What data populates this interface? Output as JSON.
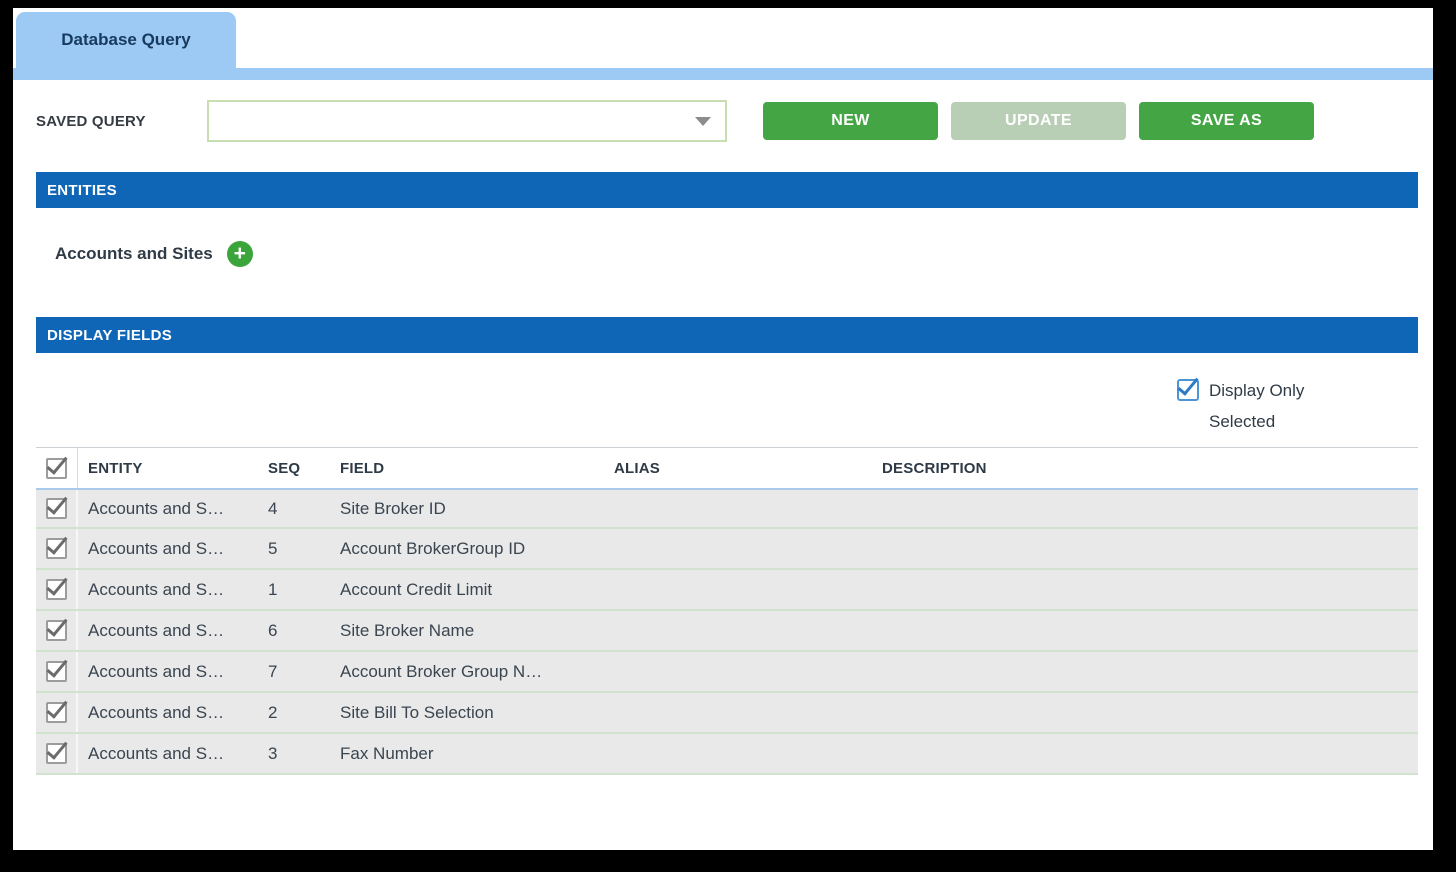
{
  "tab": {
    "label": "Database Query"
  },
  "saved_query": {
    "label": "SAVED QUERY",
    "value": "",
    "dropdown_icon": "chevron-down-icon"
  },
  "buttons": {
    "new": "NEW",
    "update": "UPDATE",
    "save_as": "SAVE AS",
    "update_disabled": true
  },
  "sections": {
    "entities": "ENTITIES",
    "display_fields": "DISPLAY FIELDS"
  },
  "entities": {
    "item_label": "Accounts and Sites",
    "add_icon": "plus-icon"
  },
  "display_options": {
    "label": "Display Only Selected",
    "checked": true
  },
  "table": {
    "select_all_checked": true,
    "columns": [
      "ENTITY",
      "SEQ",
      "FIELD",
      "ALIAS",
      "DESCRIPTION"
    ],
    "rows": [
      {
        "checked": true,
        "entity": "Accounts and S…",
        "seq": "4",
        "field": "Site Broker ID",
        "alias": "",
        "description": ""
      },
      {
        "checked": true,
        "entity": "Accounts and S…",
        "seq": "5",
        "field": "Account BrokerGroup ID",
        "alias": "",
        "description": ""
      },
      {
        "checked": true,
        "entity": "Accounts and S…",
        "seq": "1",
        "field": "Account Credit Limit",
        "alias": "",
        "description": ""
      },
      {
        "checked": true,
        "entity": "Accounts and S…",
        "seq": "6",
        "field": "Site Broker Name",
        "alias": "",
        "description": ""
      },
      {
        "checked": true,
        "entity": "Accounts and S…",
        "seq": "7",
        "field": "Account Broker Group N…",
        "alias": "",
        "description": ""
      },
      {
        "checked": true,
        "entity": "Accounts and S…",
        "seq": "2",
        "field": "Site Bill To Selection",
        "alias": "",
        "description": ""
      },
      {
        "checked": true,
        "entity": "Accounts and S…",
        "seq": "3",
        "field": "Fax Number",
        "alias": "",
        "description": ""
      }
    ]
  },
  "colors": {
    "tab_blue": "#9DCAF4",
    "section_blue": "#0F66B6",
    "button_green": "#44A544",
    "button_disabled_green": "#B9CFB5",
    "plus_green": "#3BA53B",
    "checkbox_blue": "#4C94D8",
    "dropdown_border_green": "#C9DDB2",
    "row_gray": "#E9E9E9"
  }
}
